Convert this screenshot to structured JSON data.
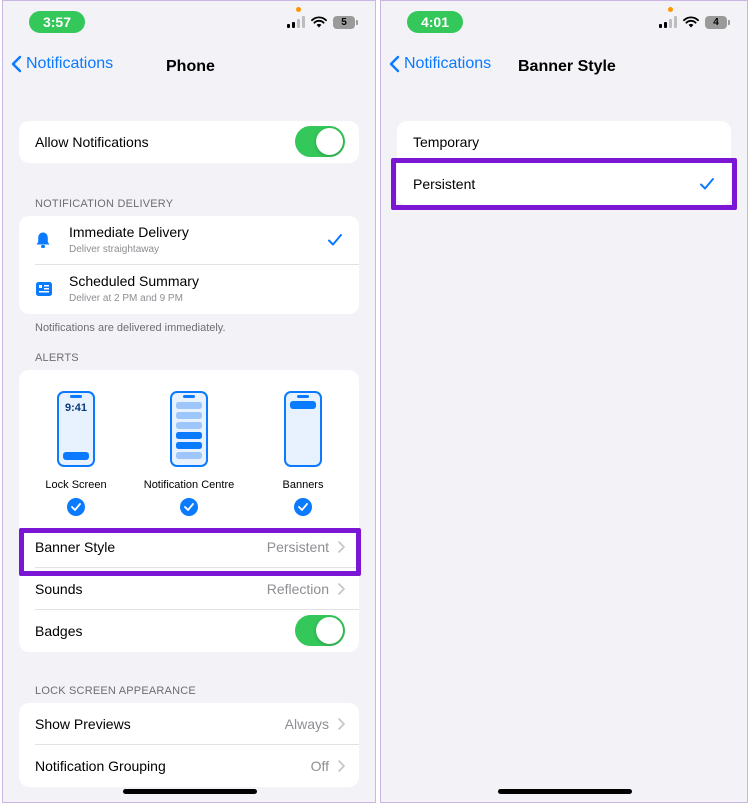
{
  "left": {
    "status": {
      "time": "3:57",
      "battery": "5"
    },
    "nav": {
      "back_label": "Notifications",
      "title": "Phone"
    },
    "allow_notifications": {
      "label": "Allow Notifications"
    },
    "delivery": {
      "section_label": "NOTIFICATION DELIVERY",
      "items": [
        {
          "title": "Immediate Delivery",
          "subtitle": "Deliver straightaway"
        },
        {
          "title": "Scheduled Summary",
          "subtitle": "Deliver at 2 PM and 9 PM"
        }
      ],
      "footnote": "Notifications are delivered immediately."
    },
    "alerts": {
      "section_label": "ALERTS",
      "lock_time": "9:41",
      "items": [
        {
          "label": "Lock Screen"
        },
        {
          "label": "Notification Centre"
        },
        {
          "label": "Banners"
        }
      ]
    },
    "banner_style": {
      "label": "Banner Style",
      "value": "Persistent"
    },
    "sounds": {
      "label": "Sounds",
      "value": "Reflection"
    },
    "badges": {
      "label": "Badges"
    },
    "lock_screen": {
      "section_label": "LOCK SCREEN APPEARANCE",
      "show_previews": {
        "label": "Show Previews",
        "value": "Always"
      },
      "grouping": {
        "label": "Notification Grouping",
        "value": "Off"
      }
    }
  },
  "right": {
    "status": {
      "time": "4:01",
      "battery": "4"
    },
    "nav": {
      "back_label": "Notifications",
      "title": "Banner Style"
    },
    "options": [
      {
        "label": "Temporary"
      },
      {
        "label": "Persistent"
      }
    ]
  },
  "colors": {
    "accent": "#0a7aff",
    "toggle_on": "#34c759",
    "highlight": "#7b16d4"
  }
}
